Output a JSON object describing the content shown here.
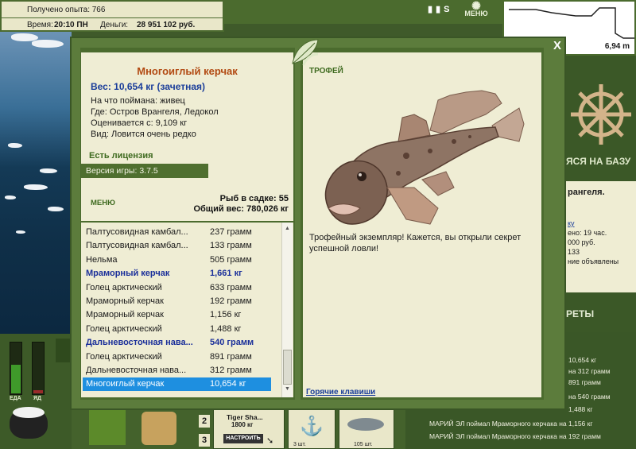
{
  "header": {
    "xp_label": "Получено опыта: 766",
    "time_label": "Время:",
    "time_value": "20:10 ПН",
    "money_label": "Деньги:",
    "money_value": "28 951 102 руб.",
    "menu_label": "МЕНЮ"
  },
  "depth": {
    "value": "6,94 m"
  },
  "right_panel": {
    "base_label": "ЯСЯ НА БАЗУ",
    "info_lines": [
      "рангеля.",
      "",
      "ку",
      "ено: 19 час.",
      "000 руб.",
      "133",
      "ние объявлены"
    ],
    "secrets_label": "РЕТЫ"
  },
  "catch_log": [
    "10,654 кг",
    "на 312 грамм",
    "891 грамм",
    "на 540 грамм",
    "1,488 кг",
    "МАРИЙ ЭЛ поймал Мраморного керчака на 1,156 кг",
    "МАРИЙ ЭЛ поймал Мраморного керчака на 192 грамм"
  ],
  "left_panel": {
    "food_label": "ЕДА",
    "poison_label": "ЯД"
  },
  "bottom": {
    "lure_name": "Tiger Sha...",
    "lure_weight": "1800 кг",
    "tune_button": "НАСТРОИТЬ",
    "slot2": "2",
    "slot3": "3",
    "pcs1": "3 шт.",
    "pcs2": "105 шт."
  },
  "modal": {
    "close_label": "X",
    "fish_name": "Многоиглый керчак",
    "weight_line": "Вес: 10,654 кг (зачетная)",
    "bait_line": "На что поймана: живец",
    "place_line": "Где: Остров Врангеля, Ледокол",
    "price_line": "Оценивается с: 9,109 кг",
    "kind_line": "Вид: Ловится очень редко",
    "licence": "Есть лицензия",
    "version": "Версия игры: 3.7.5",
    "menu_button": "МЕНЮ",
    "cage_count": "Рыб в садке: 55",
    "total_weight": "Общий вес: 780,026 кг",
    "trophy_label": "ТРОФЕЙ",
    "trophy_text": "Трофейный экземпляр! Кажется, вы открыли секрет успешной ловли!",
    "hotkeys": "Горячие клавиши",
    "catches": [
      {
        "name": "Палтусовидная камбал...",
        "weight": "237 грамм",
        "bold": false
      },
      {
        "name": "Палтусовидная камбал...",
        "weight": "133 грамм",
        "bold": false
      },
      {
        "name": "Нельма",
        "weight": "505 грамм",
        "bold": false
      },
      {
        "name": "Мраморный керчак",
        "weight": "1,661 кг",
        "bold": true
      },
      {
        "name": "Голец арктический",
        "weight": "633 грамм",
        "bold": false
      },
      {
        "name": "Мраморный керчак",
        "weight": "192 грамм",
        "bold": false
      },
      {
        "name": "Мраморный керчак",
        "weight": "1,156 кг",
        "bold": false
      },
      {
        "name": "Голец арктический",
        "weight": "1,488 кг",
        "bold": false
      },
      {
        "name": "Дальневосточная нава...",
        "weight": "540 грамм",
        "bold": true
      },
      {
        "name": "Голец арктический",
        "weight": "891 грамм",
        "bold": false
      },
      {
        "name": "Дальневосточная нава...",
        "weight": "312 грамм",
        "bold": false
      },
      {
        "name": "Многоиглый керчак",
        "weight": "10,654 кг",
        "bold": false,
        "selected": true
      }
    ]
  }
}
